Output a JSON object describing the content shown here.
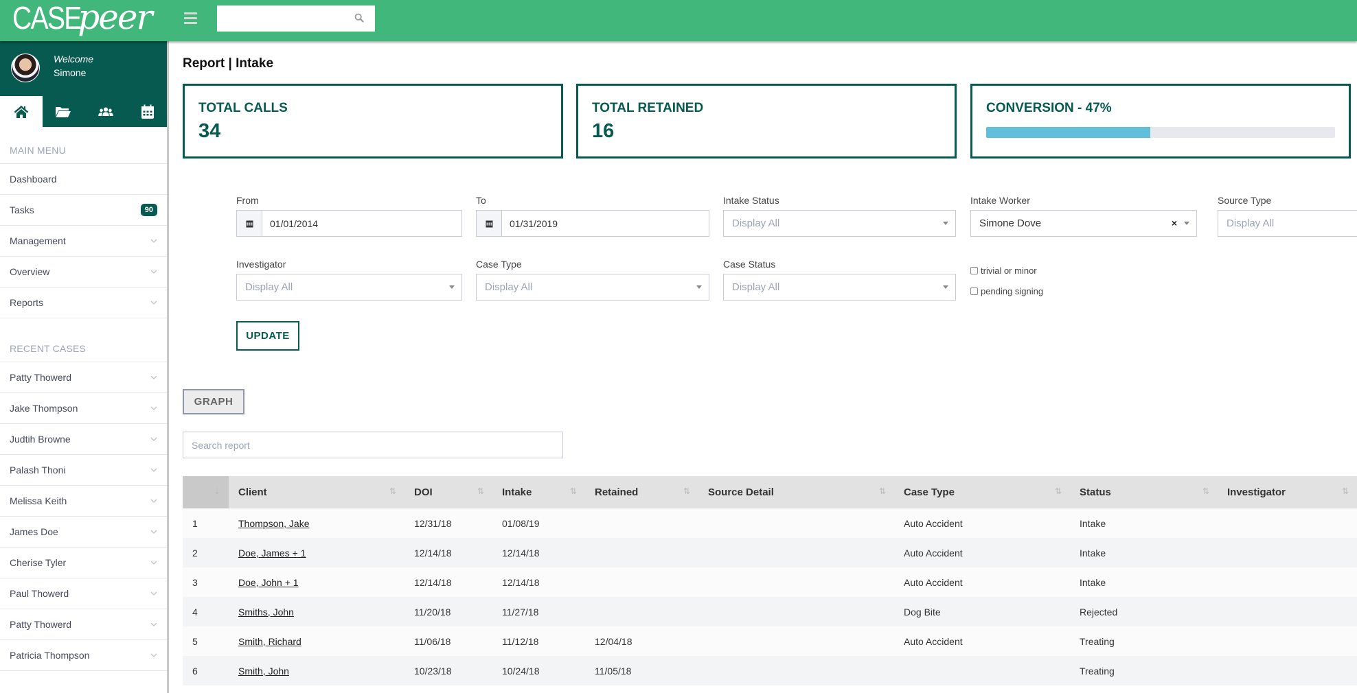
{
  "app": {
    "logo_case": "CASE",
    "logo_peer": "peer",
    "search_placeholder": ""
  },
  "user": {
    "welcome": "Welcome",
    "name": "Simone"
  },
  "sidebar": {
    "icon_tabs": [
      {
        "name": "home-icon",
        "active": true
      },
      {
        "name": "folder-icon",
        "active": false
      },
      {
        "name": "users-icon",
        "active": false
      },
      {
        "name": "calendar-icon",
        "active": false
      }
    ],
    "main_menu_heading": "MAIN MENU",
    "main_menu": [
      {
        "label": "Dashboard",
        "badge": null,
        "chevron": false
      },
      {
        "label": "Tasks",
        "badge": "90",
        "chevron": false
      },
      {
        "label": "Management",
        "badge": null,
        "chevron": true
      },
      {
        "label": "Overview",
        "badge": null,
        "chevron": true
      },
      {
        "label": "Reports",
        "badge": null,
        "chevron": true
      }
    ],
    "recent_heading": "RECENT CASES",
    "recent_cases": [
      "Patty Thowerd",
      "Jake Thompson",
      "Judtih Browne",
      "Palash Thoni",
      "Melissa Keith",
      "James Doe",
      "Cherise Tyler",
      "Paul Thowerd",
      "Patty Thowerd",
      "Patricia Thompson"
    ]
  },
  "page": {
    "title": "Report | Intake"
  },
  "cards": {
    "total_calls_label": "TOTAL CALLS",
    "total_calls_value": "34",
    "total_retained_label": "TOTAL RETAINED",
    "total_retained_value": "16",
    "conversion_label": "CONVERSION - 47%",
    "conversion_percent": 47
  },
  "filters": {
    "from_label": "From",
    "from_value": "01/01/2014",
    "to_label": "To",
    "to_value": "01/31/2019",
    "intake_status_label": "Intake Status",
    "intake_status_value": "Display All",
    "intake_worker_label": "Intake Worker",
    "intake_worker_value": "Simone Dove",
    "source_type_label": "Source Type",
    "source_type_value": "Display All",
    "investigator_label": "Investigator",
    "investigator_value": "Display All",
    "case_type_label": "Case Type",
    "case_type_value": "Display All",
    "case_status_label": "Case Status",
    "case_status_value": "Display All",
    "trivial_label": "trivial or minor",
    "pending_label": "pending signing",
    "update_label": "UPDATE"
  },
  "report": {
    "graph_label": "GRAPH",
    "search_placeholder": "Search report",
    "columns": [
      "",
      "Client",
      "DOI",
      "Intake",
      "Retained",
      "Source Detail",
      "Case Type",
      "Status",
      "Investigator"
    ],
    "rows": [
      {
        "n": "1",
        "client": "Thompson, Jake",
        "doi": "12/31/18",
        "intake": "01/08/19",
        "retained": "",
        "source": "",
        "case_type": "Auto Accident",
        "status": "Intake",
        "investigator": ""
      },
      {
        "n": "2",
        "client": "Doe, James + 1",
        "doi": "12/14/18",
        "intake": "12/14/18",
        "retained": "",
        "source": "",
        "case_type": "Auto Accident",
        "status": "Intake",
        "investigator": ""
      },
      {
        "n": "3",
        "client": "Doe, John + 1",
        "doi": "12/14/18",
        "intake": "12/14/18",
        "retained": "",
        "source": "",
        "case_type": "Auto Accident",
        "status": "Intake",
        "investigator": ""
      },
      {
        "n": "4",
        "client": "Smiths, John",
        "doi": "11/20/18",
        "intake": "11/27/18",
        "retained": "",
        "source": "",
        "case_type": "Dog Bite",
        "status": "Rejected",
        "investigator": ""
      },
      {
        "n": "5",
        "client": "Smith, Richard",
        "doi": "11/06/18",
        "intake": "11/12/18",
        "retained": "12/04/18",
        "source": "",
        "case_type": "Auto Accident",
        "status": "Treating",
        "investigator": ""
      },
      {
        "n": "6",
        "client": "Smith, John",
        "doi": "10/23/18",
        "intake": "10/24/18",
        "retained": "11/05/18",
        "source": "",
        "case_type": "",
        "status": "Treating",
        "investigator": ""
      }
    ]
  }
}
